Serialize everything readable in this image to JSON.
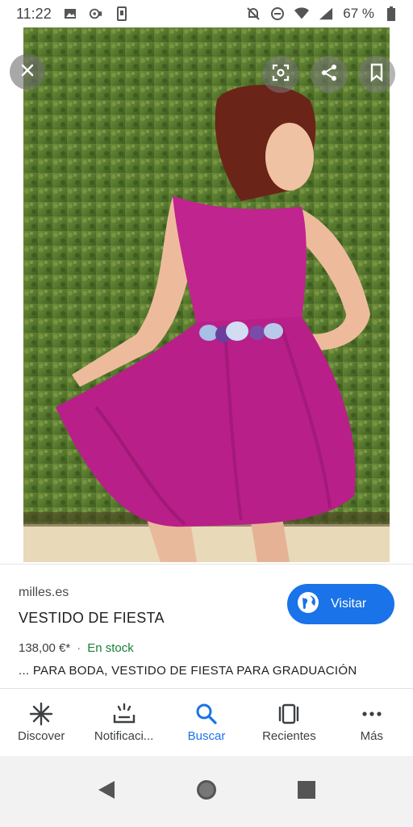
{
  "status_bar": {
    "time": "11:22",
    "battery": "67 %",
    "icons": [
      "image-icon",
      "assistant-icon",
      "phone-icon",
      "mute-icon",
      "dnd-icon",
      "wifi-icon",
      "signal-icon",
      "battery-icon"
    ]
  },
  "image_viewer": {
    "buttons": [
      "close-icon",
      "lens-icon",
      "share-icon",
      "bookmark-icon"
    ]
  },
  "result": {
    "source": "milles.es",
    "title": "VESTIDO DE FIESTA",
    "visit_label": "Visitar",
    "price": "138,00 €*",
    "separator": "·",
    "stock": "En stock",
    "description": "... PARA BODA, VESTIDO DE FIESTA PARA GRADUACIÓN"
  },
  "bottom_nav": {
    "items": [
      {
        "label": "Discover",
        "icon": "asterisk-icon"
      },
      {
        "label": "Notificaci...",
        "icon": "notifications-icon"
      },
      {
        "label": "Buscar",
        "icon": "search-icon",
        "active": true
      },
      {
        "label": "Recientes",
        "icon": "recents-icon"
      },
      {
        "label": "Más",
        "icon": "more-icon"
      }
    ]
  },
  "colors": {
    "accent": "#1a73e8",
    "stock": "#188038",
    "dress": "#c0248f"
  }
}
